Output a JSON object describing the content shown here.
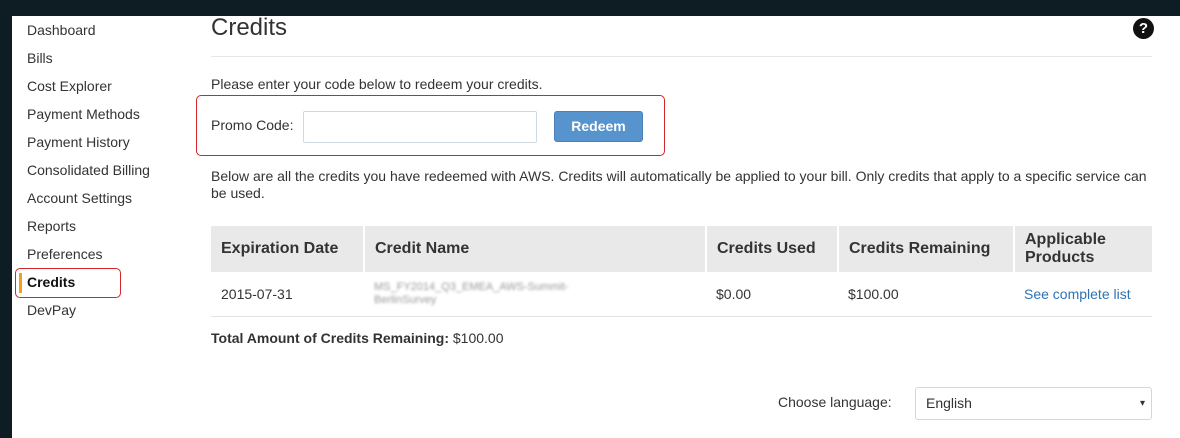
{
  "sidebar": {
    "items": [
      {
        "label": "Dashboard"
      },
      {
        "label": "Bills"
      },
      {
        "label": "Cost Explorer"
      },
      {
        "label": "Payment Methods"
      },
      {
        "label": "Payment History"
      },
      {
        "label": "Consolidated Billing"
      },
      {
        "label": "Account Settings"
      },
      {
        "label": "Reports"
      },
      {
        "label": "Preferences"
      },
      {
        "label": "Credits"
      },
      {
        "label": "DevPay"
      }
    ],
    "active": "Credits"
  },
  "page": {
    "title": "Credits",
    "help_icon": "question-circle-icon",
    "intro": "Please enter your code below to redeem your credits.",
    "promo_label": "Promo Code:",
    "promo_value": "",
    "redeem_label": "Redeem",
    "description": "Below are all the credits you have redeemed with AWS. Credits will automatically be applied to your bill. Only credits that apply to a specific service can be used."
  },
  "table": {
    "headers": [
      "Expiration Date",
      "Credit Name",
      "Credits Used",
      "Credits Remaining",
      "Applicable Products"
    ],
    "rows": [
      {
        "expiration": "2015-07-31",
        "name": "MS_FY2014_Q3_EMEA_AWS-Summit-BerlinSurvey",
        "used": "$0.00",
        "remaining": "$100.00",
        "products": "See complete list"
      }
    ]
  },
  "total": {
    "label": "Total Amount of Credits Remaining:",
    "value": "$100.00"
  },
  "language": {
    "label": "Choose language:",
    "selected": "English"
  },
  "colors": {
    "accent": "#f89c1c",
    "highlight_border": "#d0262c",
    "button": "#5793cd",
    "link": "#2f73b5"
  }
}
